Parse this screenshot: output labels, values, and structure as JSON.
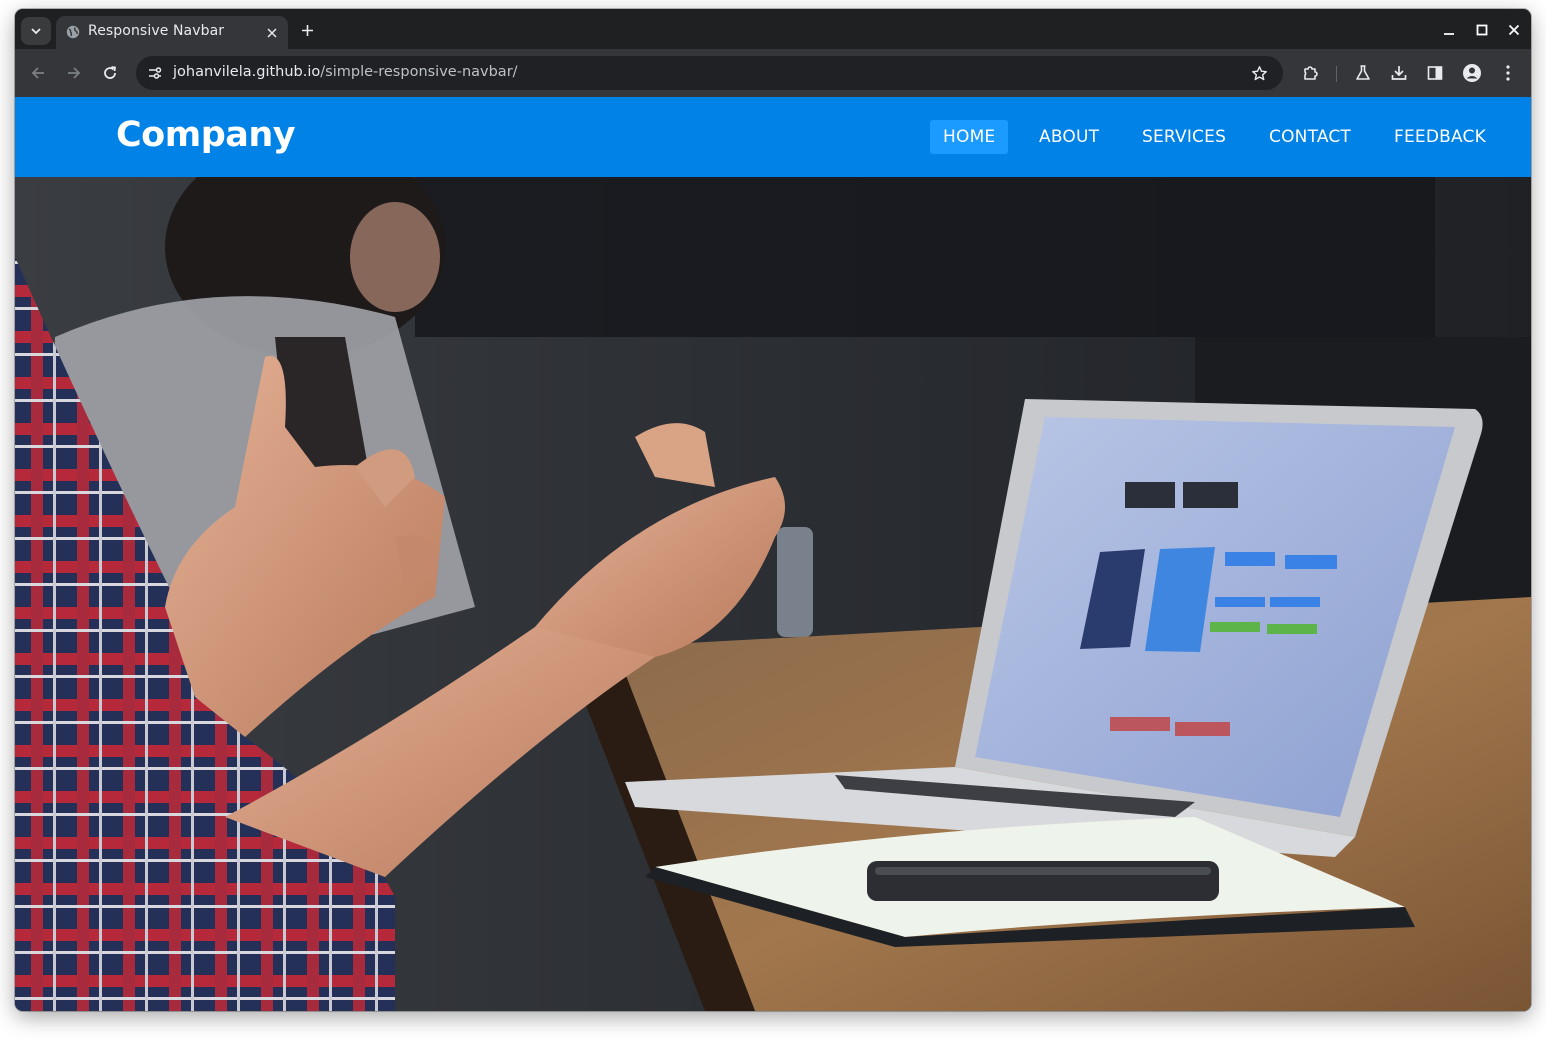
{
  "browser": {
    "tab_title": "Responsive Navbar",
    "url_host": "johanvilela.github.io",
    "url_path": "/simple-responsive-navbar/",
    "icons": [
      "tab-search-icon",
      "globe-icon",
      "close-icon",
      "plus-icon",
      "minimize-icon",
      "maximize-icon",
      "window-close-icon",
      "back-arrow-icon",
      "forward-arrow-icon",
      "reload-icon",
      "site-info-icon",
      "star-icon",
      "extensions-icon",
      "labs-icon",
      "download-icon",
      "side-panel-icon",
      "profile-icon",
      "more-vert-icon"
    ]
  },
  "navbar": {
    "brand": "Company",
    "items": [
      {
        "label": "HOME",
        "active": true
      },
      {
        "label": "ABOUT",
        "active": false
      },
      {
        "label": "SERVICES",
        "active": false
      },
      {
        "label": "CONTACT",
        "active": false
      },
      {
        "label": "FEEDBACK",
        "active": false
      }
    ]
  },
  "colors": {
    "navbar_bg": "#0082e6",
    "nav_active_bg": "#1b9bff",
    "browser_frame": "#1f2021",
    "toolbar": "#35363a"
  }
}
